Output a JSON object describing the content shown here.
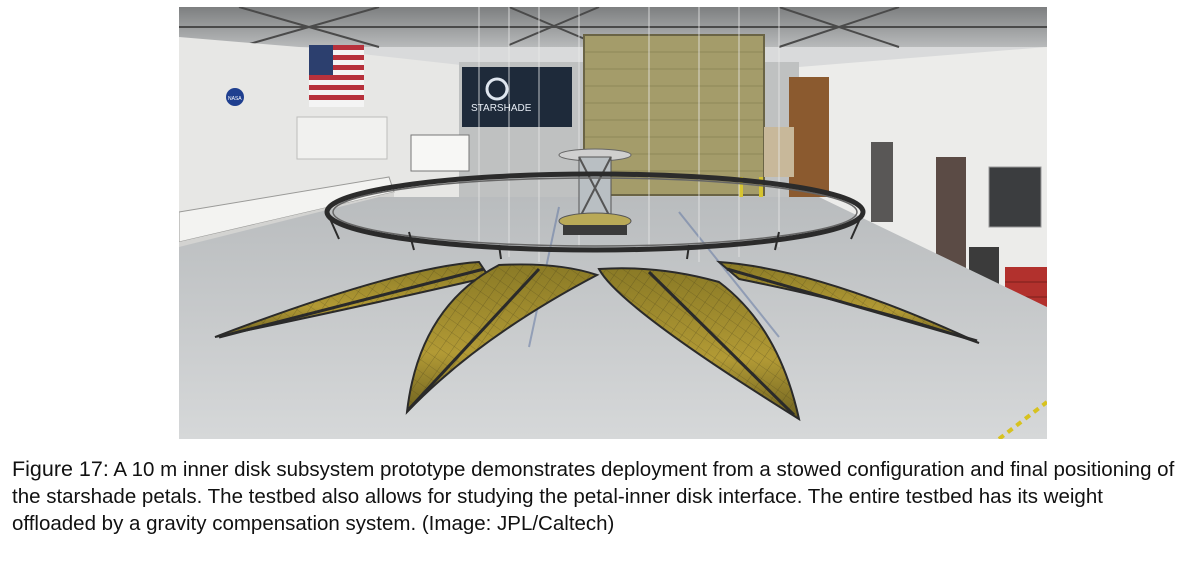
{
  "figure": {
    "photo_signs": {
      "banner": "STARSHADE",
      "logo": "NASA"
    },
    "caption": {
      "label": "Figure 17:",
      "text": " A 10 m inner disk subsystem prototype demonstrates deployment from a stowed configuration and final positioning of the starshade petals. The testbed also allows for studying the petal-inner disk interface. The entire testbed has its weight offloaded by a gravity compensation system.  (Image: JPL/Caltech)"
    }
  },
  "colors": {
    "petal_fill": "#a08a2a",
    "frame": "#2b2b2b",
    "floor": "#c9ccce",
    "caption_text": "#111111"
  }
}
